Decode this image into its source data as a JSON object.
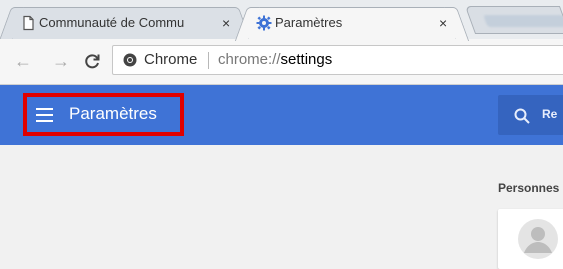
{
  "tabs": [
    {
      "title": "Communauté de Commu",
      "close": "×",
      "icon": "page-icon"
    },
    {
      "title": "Paramètres",
      "close": "×",
      "icon": "gear-icon"
    }
  ],
  "toolbar": {
    "back_icon": "←",
    "forward_icon": "→",
    "reload_icon": "C",
    "omnibox_label": "Chrome",
    "url_scheme": "chrome://",
    "url_host": "settings"
  },
  "header": {
    "title": "Paramètres",
    "search_placeholder": "Re"
  },
  "section": {
    "title": "Personnes"
  },
  "colors": {
    "header": "#3f73d6",
    "search_box": "#3564bf",
    "highlight": "#e00000"
  }
}
